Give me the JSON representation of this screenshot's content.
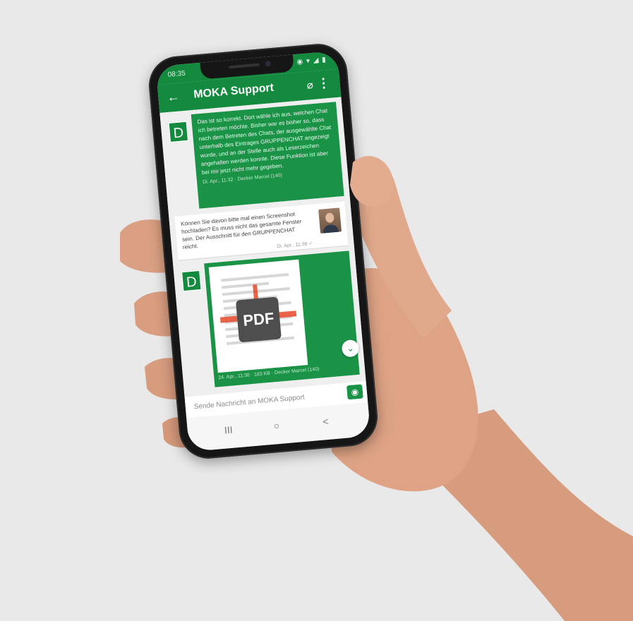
{
  "status_bar": {
    "time": "08:35",
    "icons": "◉ ▾ ◢ ▮"
  },
  "app_bar": {
    "back_icon": "arrow-left-icon",
    "title": "MOKA Support",
    "attach_icon": "paperclip-icon",
    "more_icon": "more-vertical-icon"
  },
  "messages": [
    {
      "direction": "outgoing",
      "avatar_letter": "D",
      "text": "Das ist so korrekt. Dort wähle ich aus, welchen Chat ich betreten möchte. Bisher war es bisher so, dass nach dem Betreten des Chats, der ausgewählte Chat unterhalb des Eintrages GRUPPENCHAT angezeigt wurde, und an der Stelle auch als Leserzeichen angehalten werden konnte. Diese Funktion ist aber bei mir jetzt nicht mehr gegeben.",
      "meta": "Di. Apr., 11:32 · Decker Marcel (140)"
    },
    {
      "direction": "incoming",
      "text": "Können Sie davon bitte mal einen Screenshot hochladen? Es muss nicht das gesamte Fenster sein. Der Ausschnitt für den GRUPPENCHAT reicht.",
      "meta": "Di. Apr., 11:38 ✓"
    },
    {
      "direction": "outgoing",
      "avatar_letter": "D",
      "attachment": "PDF",
      "meta": "24. Apr., 11:38 · 183 KB · Decker Marcel (140)"
    }
  ],
  "composer": {
    "placeholder": "Sende Nachricht an MOKA Support",
    "camera_icon": "camera-icon"
  },
  "nav_bar": {
    "recents": "III",
    "home": "○",
    "back": "<"
  },
  "colors": {
    "brand_green": "#138a3e",
    "bubble_green": "#1a9346",
    "background": "#e9e9e9"
  }
}
